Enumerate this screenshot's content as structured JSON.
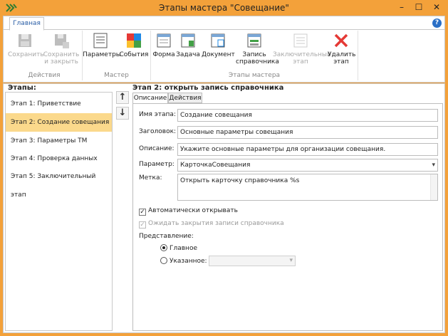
{
  "window": {
    "title": "Этапы мастера \"Совещание\"",
    "minimize": "–",
    "maximize": "☐",
    "close": "✕"
  },
  "ribbon": {
    "tab": "Главная",
    "help": "?",
    "buttons": {
      "save": "Сохранить",
      "save_close_1": "Сохранить",
      "save_close_2": "и закрыть",
      "params": "Параметры",
      "events": "События",
      "form": "Форма",
      "task": "Задача",
      "document": "Документ",
      "ref_record_1": "Запись",
      "ref_record_2": "справочника",
      "final_1": "Заключительный",
      "final_2": "этап",
      "delete_1": "Удалить",
      "delete_2": "этап"
    },
    "groups": {
      "actions": "Действия",
      "wizard": "Мастер",
      "stages": "Этапы мастера"
    }
  },
  "stages_label": "Этапы:",
  "stages": [
    "Этап 1: Приветствие",
    "Этап 2: Создание совещания",
    "Этап 3: Параметры ТМ",
    "Этап 4: Проверка данных",
    "Этап 5: Заключительный этап"
  ],
  "stage_header": "Этап 2: открыть запись справочника",
  "tabs": {
    "description": "Описание",
    "actions": "Действия"
  },
  "form": {
    "name_label": "Имя этапа:",
    "name_value": "Создание совещания",
    "heading_label": "Заголовок:",
    "heading_value": "Основные параметры совещания",
    "desc_label": "Описание:",
    "desc_value": "Укажите основные параметры для организации совещания.",
    "param_label": "Параметр:",
    "param_value": "КарточкаСовещания",
    "mark_label": "Метка:",
    "mark_value": "Открыть карточку справочника %s",
    "auto_open": "Автоматически открывать",
    "wait_close": "Ожидать закрытия записи справочника",
    "view_label": "Представление:",
    "view_main": "Главное",
    "view_specified": "Указанное:"
  },
  "colors": {
    "accent": "#f3a13a",
    "selection": "#fbd98c",
    "link": "#2a5ea6"
  }
}
